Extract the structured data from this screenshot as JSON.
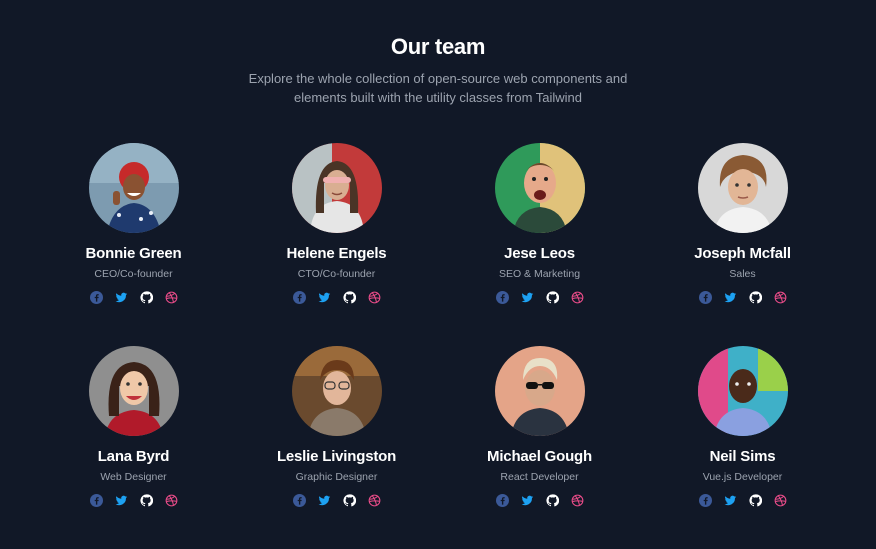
{
  "section": {
    "title": "Our team",
    "subtitle_line1": "Explore the whole collection of open-source web components and",
    "subtitle_line2": "elements built with the utility classes from Tailwind"
  },
  "colors": {
    "background": "#111827",
    "facebook": "#3b5998",
    "twitter": "#1da1f2",
    "github": "#ffffff",
    "dribbble": "#ea4c89"
  },
  "social_icons": [
    "facebook-icon",
    "twitter-icon",
    "github-icon",
    "dribbble-icon"
  ],
  "members": [
    {
      "name": "Bonnie Green",
      "role": "CEO/Co-founder"
    },
    {
      "name": "Helene Engels",
      "role": "CTO/Co-founder"
    },
    {
      "name": "Jese Leos",
      "role": "SEO & Marketing"
    },
    {
      "name": "Joseph Mcfall",
      "role": "Sales"
    },
    {
      "name": "Lana Byrd",
      "role": "Web Designer"
    },
    {
      "name": "Leslie Livingston",
      "role": "Graphic Designer"
    },
    {
      "name": "Michael Gough",
      "role": "React Developer"
    },
    {
      "name": "Neil Sims",
      "role": "Vue.js Developer"
    }
  ]
}
